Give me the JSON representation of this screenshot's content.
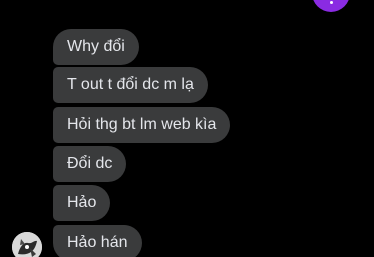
{
  "conversation": {
    "messages": [
      {
        "text": "Why đổi"
      },
      {
        "text": "T out t đổi dc m lạ"
      },
      {
        "text": "Hỏi thg bt lm web kìa"
      },
      {
        "text": "Đổi dc"
      },
      {
        "text": "Hảo"
      },
      {
        "text": "Hảo hán"
      }
    ]
  },
  "colors": {
    "background": "#000000",
    "received_bubble": "#3a3b3c",
    "message_text": "#e4e6eb",
    "sent_accent": "#8a2be2"
  },
  "icons": {
    "sender_avatar": "avatar-icon"
  }
}
